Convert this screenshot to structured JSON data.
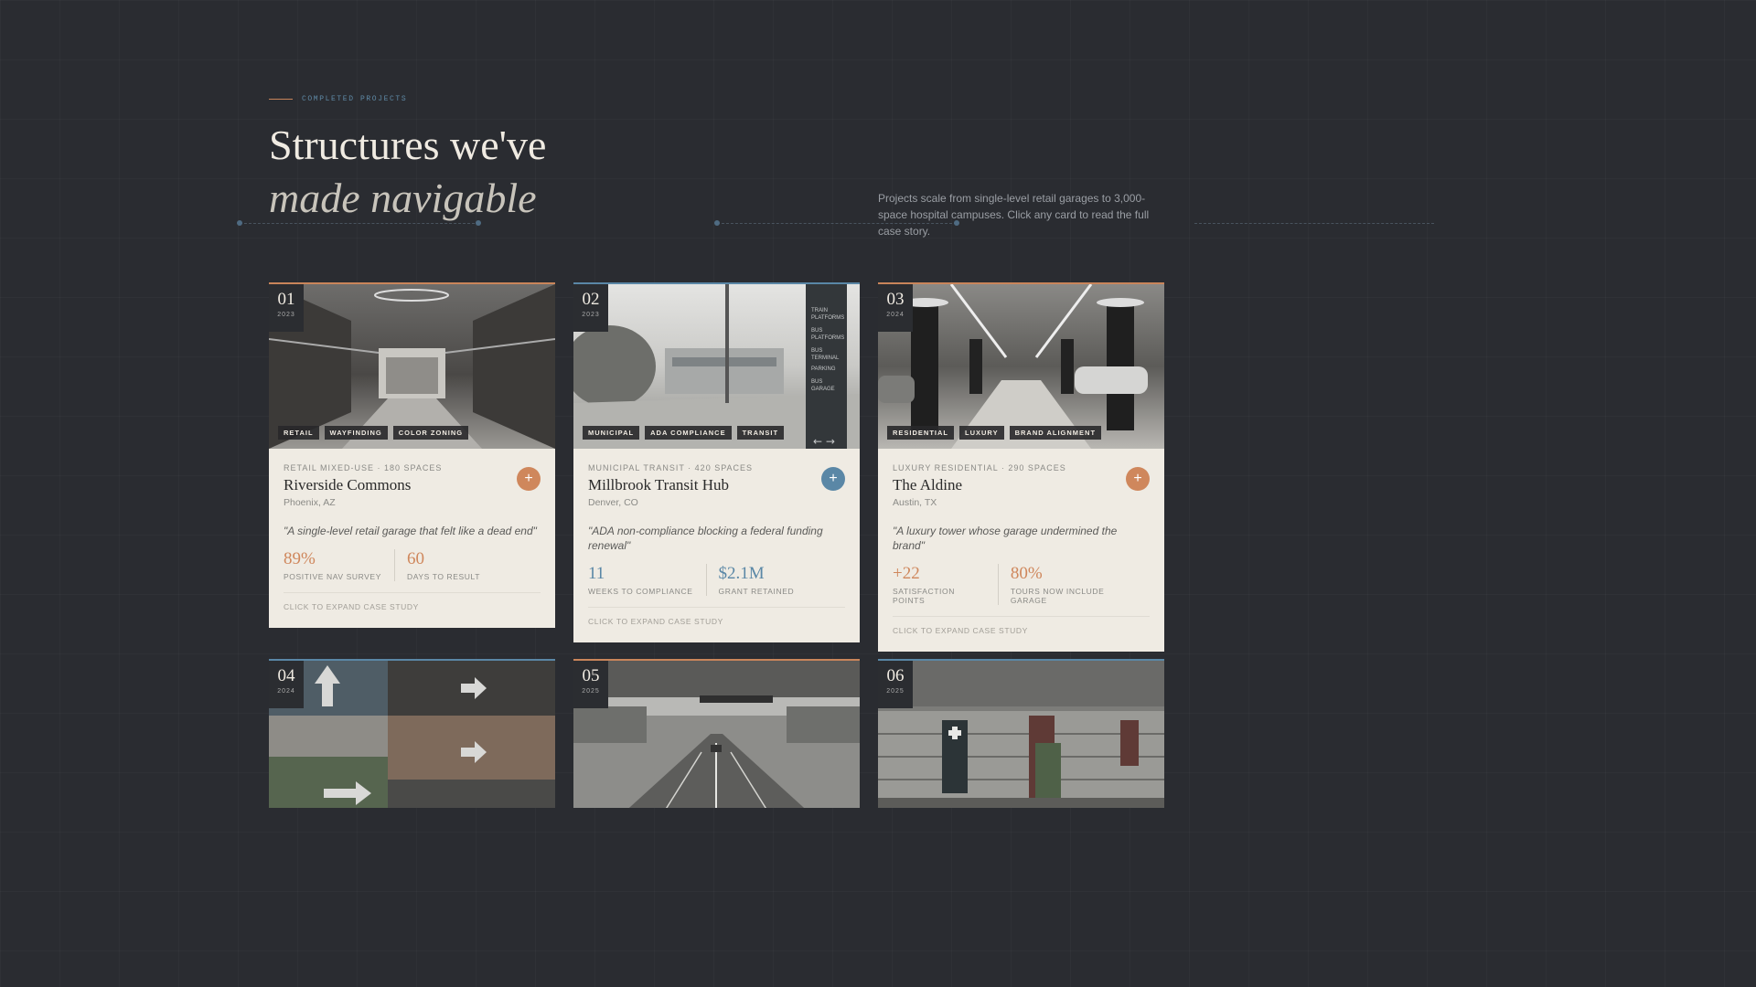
{
  "header": {
    "eyebrow": "COMPLETED PROJECTS",
    "title_line1": "Structures we've",
    "title_line2": "made navigable",
    "lead": "Projects scale from single-level retail garages to 3,000-space hospital campuses. Click any card to read the full case story."
  },
  "colors": {
    "accent_orange": "#cf875c",
    "accent_blue": "#5a87a6",
    "background": "#2a2c31",
    "card": "#efebe3"
  },
  "cards": [
    {
      "num": "01",
      "year": "2023",
      "accent": "orange",
      "image": "parking-atrium-photo",
      "tags": [
        "RETAIL",
        "WAYFINDING",
        "COLOR ZONING"
      ],
      "category": "RETAIL MIXED-USE · 180 SPACES",
      "name": "Riverside Commons",
      "location": "Phoenix, AZ",
      "quote": "\"A single-level retail garage that felt like a dead end\"",
      "stats": [
        {
          "value": "89%",
          "label": "POSITIVE NAV SURVEY"
        },
        {
          "value": "60",
          "label": "DAYS TO RESULT"
        }
      ],
      "cta": "CLICK TO EXPAND CASE STUDY"
    },
    {
      "num": "02",
      "year": "2023",
      "accent": "blue",
      "image": "transit-plaza-photo",
      "tags": [
        "MUNICIPAL",
        "ADA COMPLIANCE",
        "TRANSIT"
      ],
      "category": "MUNICIPAL TRANSIT · 420 SPACES",
      "name": "Millbrook Transit Hub",
      "location": "Denver, CO",
      "quote": "\"ADA non-compliance blocking a federal funding renewal\"",
      "stats": [
        {
          "value": "11",
          "label": "WEEKS TO COMPLIANCE"
        },
        {
          "value": "$2.1M",
          "label": "GRANT RETAINED"
        }
      ],
      "cta": "CLICK TO EXPAND CASE STUDY"
    },
    {
      "num": "03",
      "year": "2024",
      "accent": "orange",
      "image": "luxury-garage-photo",
      "tags": [
        "RESIDENTIAL",
        "LUXURY",
        "BRAND ALIGNMENT"
      ],
      "category": "LUXURY RESIDENTIAL · 290 SPACES",
      "name": "The Aldine",
      "location": "Austin, TX",
      "quote": "\"A luxury tower whose garage undermined the brand\"",
      "stats": [
        {
          "value": "+22",
          "label": "SATISFACTION POINTS"
        },
        {
          "value": "80%",
          "label": "TOURS NOW INCLUDE GARAGE"
        }
      ],
      "cta": "CLICK TO EXPAND CASE STUDY"
    },
    {
      "num": "04",
      "year": "2024",
      "accent": "blue",
      "image": "mural-garage-photo"
    },
    {
      "num": "05",
      "year": "2025",
      "accent": "orange",
      "image": "roadway-overpass-photo"
    },
    {
      "num": "06",
      "year": "2025",
      "accent": "blue",
      "image": "hospital-campus-photo"
    }
  ]
}
